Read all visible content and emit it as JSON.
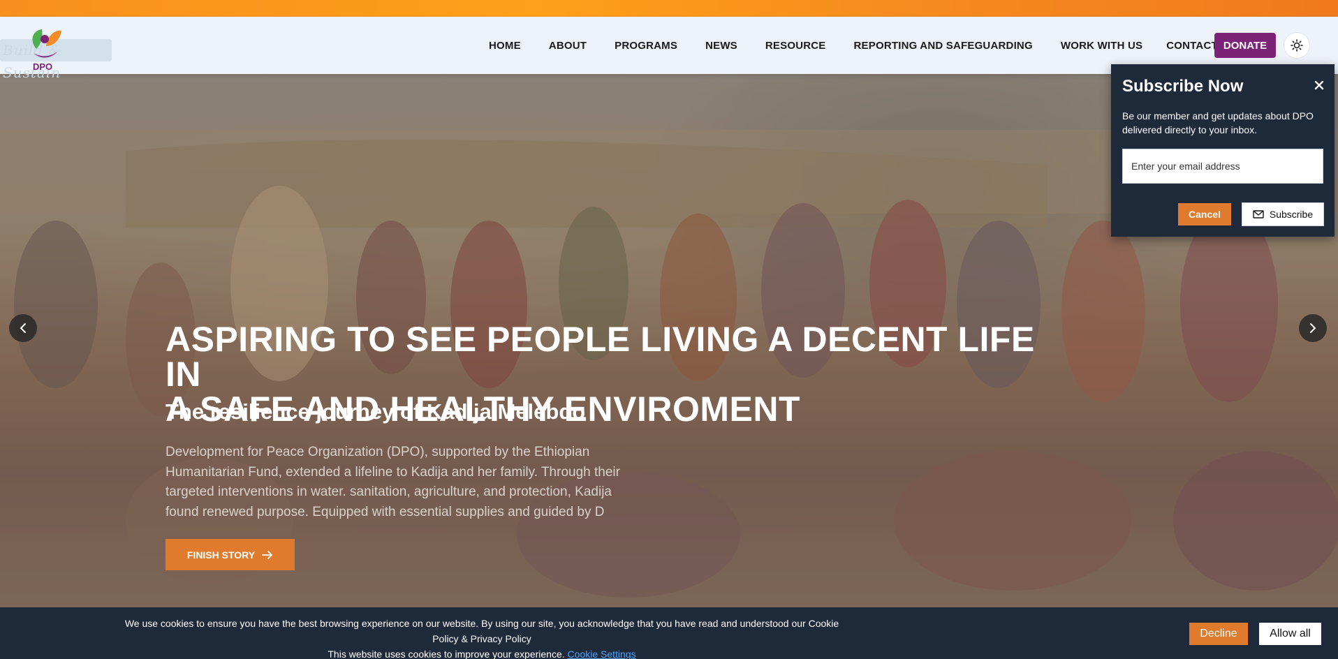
{
  "header": {
    "logo_text": "DPO",
    "logo_ghost_text": "Build & Sustain",
    "nav": [
      "HOME",
      "ABOUT",
      "PROGRAMS",
      "NEWS",
      "RESOURCE",
      "REPORTING AND SAFEGUARDING",
      "WORK WITH US",
      "CONTACT US"
    ],
    "donate_label": "DONATE",
    "theme_icon": "sun-icon"
  },
  "hero": {
    "title_line1": "ASPIRING TO SEE PEOPLE LIVING A DECENT LIFE IN",
    "title_line2": "A SAFE AND HEALTHY ENVIROMENT",
    "subtitle": "The resilience journey of Kadija Melebdo",
    "text": "Development for Peace Organization (DPO), supported by the Ethiopian Humanitarian Fund, extended a lifeline to Kadija and her family. Through their targeted interventions in water. sanitation, agriculture, and protection, Kadija found renewed purpose. Equipped with essential supplies and guided by D",
    "button_label": "FINISH STORY",
    "prev_icon": "chevron-left-icon",
    "next_icon": "chevron-right-icon"
  },
  "subscribe": {
    "title": "Subscribe Now",
    "description": "Be our member and get updates about DPO delivered directly to your inbox.",
    "email_placeholder": "Enter your email address",
    "cancel_label": "Cancel",
    "subscribe_label": "Subscribe"
  },
  "cookie": {
    "line1": "We use cookies to ensure you have the best browsing experience on our website. By using our site, you acknowledge that you have read and understood our Cookie Policy & Privacy Policy",
    "line2": "This website uses cookies to improve your experience.",
    "settings_link": "Cookie Settings",
    "decline_label": "Decline",
    "allow_label": "Allow all"
  },
  "colors": {
    "brand_purple": "#7b2376",
    "accent_orange": "#e07a2c",
    "dark_navy": "#1e2a3a"
  }
}
